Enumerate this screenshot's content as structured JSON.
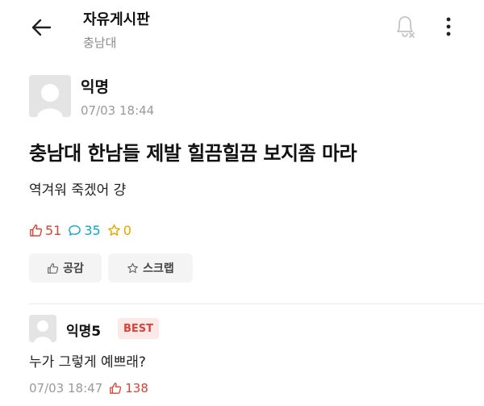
{
  "header": {
    "board_title": "자유게시판",
    "board_subtitle": "충남대",
    "icons": [
      "back-arrow-icon",
      "bell-off-icon",
      "more-vertical-icon"
    ]
  },
  "post": {
    "author": "익명",
    "date": "07/03 18:44",
    "title": "충남대 한남들 제발 힐끔힐끔 보지좀 마라",
    "body": "역겨워 죽겠어 걍",
    "stats": {
      "likes": "51",
      "comments": "35",
      "scraps": "0"
    },
    "actions": {
      "like_label": "공감",
      "scrap_label": "스크랩"
    }
  },
  "comment": {
    "author": "익명5",
    "badge": "BEST",
    "text": "누가 그렇게 예쁘래?",
    "date": "07/03 18:47",
    "likes": "138"
  },
  "colors": {
    "like": "#d0473a",
    "comment": "#11a8c4",
    "scrap": "#e3a600",
    "best_bg": "#fbe9e7",
    "muted": "#9a9a9a"
  }
}
